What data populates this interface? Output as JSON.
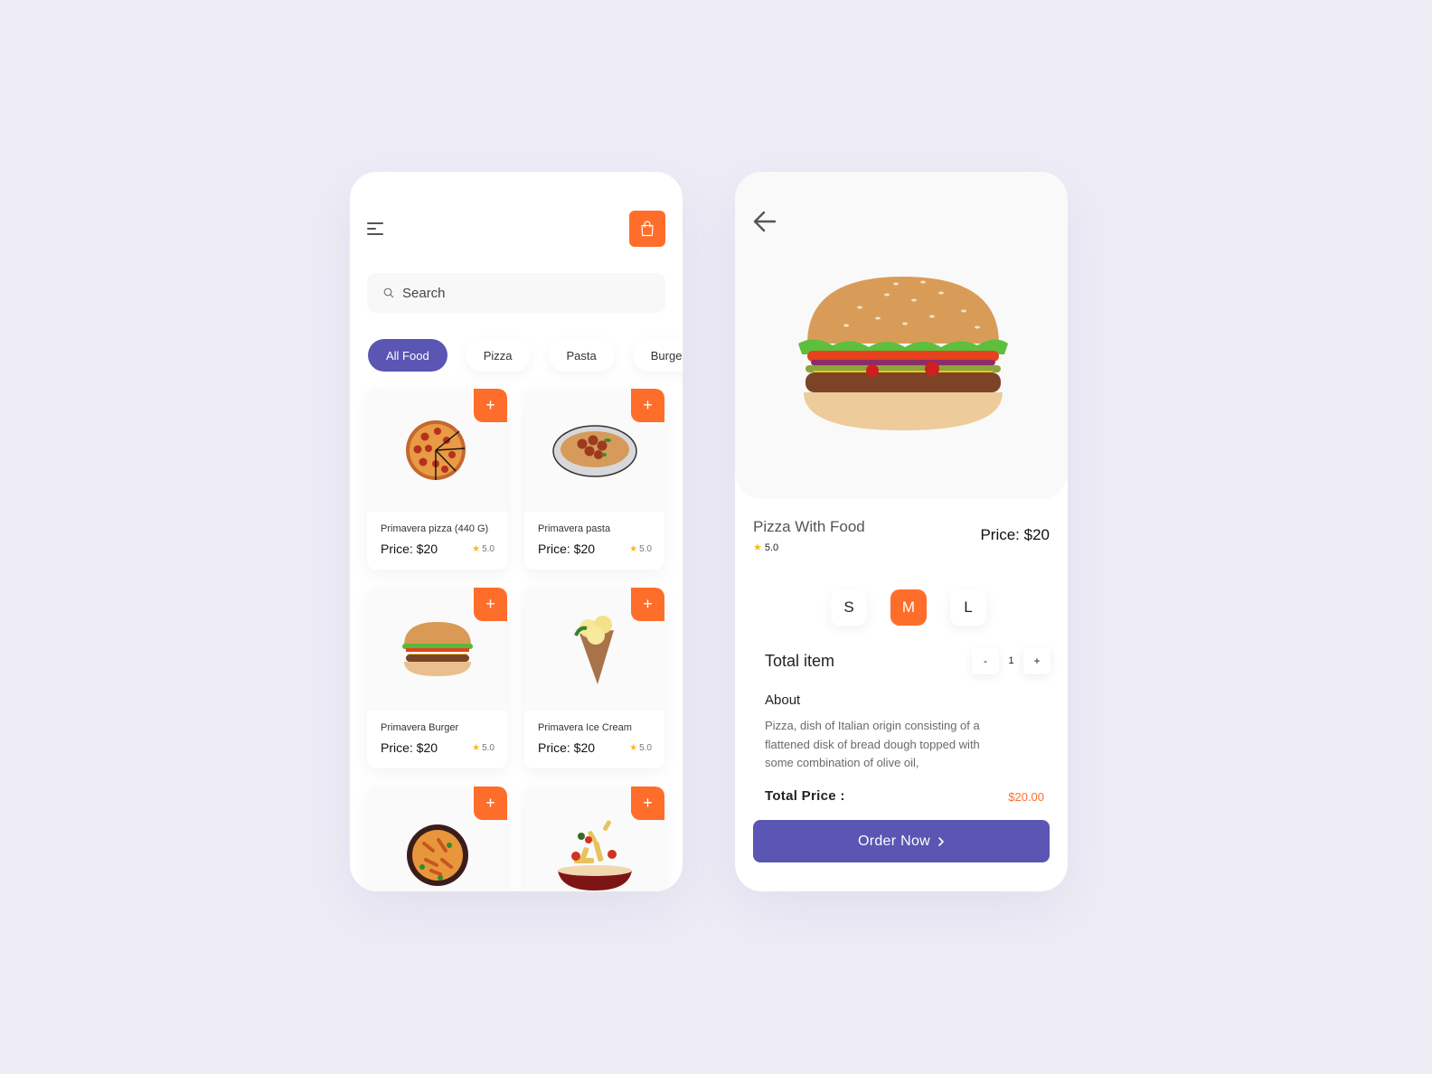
{
  "colors": {
    "accent_orange": "#ff6d2b",
    "accent_purple": "#5b55b3",
    "star_yellow": "#f7bb17",
    "background": "#eeedf6"
  },
  "list_screen": {
    "header": {
      "menu_icon": "hamburger-menu-icon",
      "cart_icon": "shopping-bag-icon"
    },
    "search": {
      "placeholder": "Search",
      "value": "",
      "icon": "search-icon"
    },
    "categories": [
      {
        "label": "All Food",
        "active": true
      },
      {
        "label": "Pizza",
        "active": false
      },
      {
        "label": "Pasta",
        "active": false
      },
      {
        "label": "Burger",
        "active": false
      }
    ],
    "items": [
      {
        "name": "Primavera pizza (440 G)",
        "price": "Price: $20",
        "rating": "5.0",
        "image": "pizza"
      },
      {
        "name": "Primavera pasta",
        "price": "Price: $20",
        "rating": "5.0",
        "image": "spaghetti-meatballs"
      },
      {
        "name": "Primavera Burger",
        "price": "Price: $20",
        "rating": "5.0",
        "image": "burger"
      },
      {
        "name": "Primavera Ice Cream",
        "price": "Price: $20",
        "rating": "5.0",
        "image": "ice-cream-cone"
      },
      {
        "name": "",
        "price": "",
        "rating": "",
        "image": "penne-bowl"
      },
      {
        "name": "",
        "price": "",
        "rating": "",
        "image": "pasta-pan"
      }
    ],
    "add_label": "+"
  },
  "detail_screen": {
    "back_icon": "arrow-left-icon",
    "title": "Pizza With Food",
    "rating": "5.0",
    "price": "Price: $20",
    "sizes": [
      {
        "label": "S",
        "active": false
      },
      {
        "label": "M",
        "active": true
      },
      {
        "label": "L",
        "active": false
      }
    ],
    "total_item_label": "Total item",
    "quantity": {
      "minus": "-",
      "value": "1",
      "plus": "+"
    },
    "about_title": "About",
    "about_text": "Pizza, dish of Italian origin consisting of a flattened disk of bread dough topped with some combination of olive oil,",
    "total_price_label": "Total Price :",
    "total_price_value": "$20.00",
    "order_button": "Order Now"
  }
}
